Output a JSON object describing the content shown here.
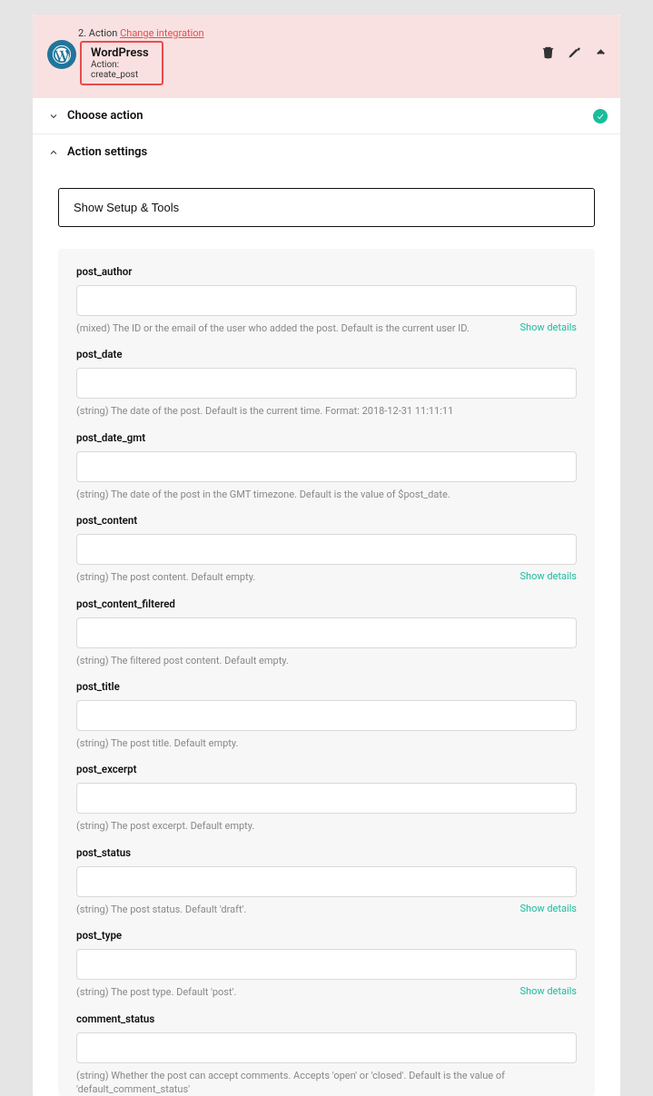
{
  "header": {
    "step_prefix": "2. Action ",
    "change_link": "Change integration",
    "title": "WordPress",
    "subtitle": "Action: create_post"
  },
  "sections": {
    "choose_action": "Choose action",
    "action_settings": "Action settings"
  },
  "setup_button": "Show Setup & Tools",
  "show_details_label": "Show details",
  "fields": [
    {
      "key": "post_author",
      "label": "post_author",
      "help": "(mixed) The ID or the email of the user who added the post. Default is the current user ID.",
      "details": true
    },
    {
      "key": "post_date",
      "label": "post_date",
      "help": "(string) The date of the post. Default is the current time. Format: 2018-12-31 11:11:11",
      "details": false
    },
    {
      "key": "post_date_gmt",
      "label": "post_date_gmt",
      "help": "(string) The date of the post in the GMT timezone. Default is the value of $post_date.",
      "details": false
    },
    {
      "key": "post_content",
      "label": "post_content",
      "help": "(string) The post content. Default empty.",
      "details": true
    },
    {
      "key": "post_content_filtered",
      "label": "post_content_filtered",
      "help": "(string) The filtered post content. Default empty.",
      "details": false
    },
    {
      "key": "post_title",
      "label": "post_title",
      "help": "(string) The post title. Default empty.",
      "details": false
    },
    {
      "key": "post_excerpt",
      "label": "post_excerpt",
      "help": "(string) The post excerpt. Default empty.",
      "details": false
    },
    {
      "key": "post_status",
      "label": "post_status",
      "help": "(string) The post status. Default 'draft'.",
      "details": true
    },
    {
      "key": "post_type",
      "label": "post_type",
      "help": "(string) The post type. Default 'post'.",
      "details": true
    },
    {
      "key": "comment_status",
      "label": "comment_status",
      "help": "(string) Whether the post can accept comments. Accepts 'open' or 'closed'. Default is the value of 'default_comment_status'",
      "details": false
    }
  ]
}
